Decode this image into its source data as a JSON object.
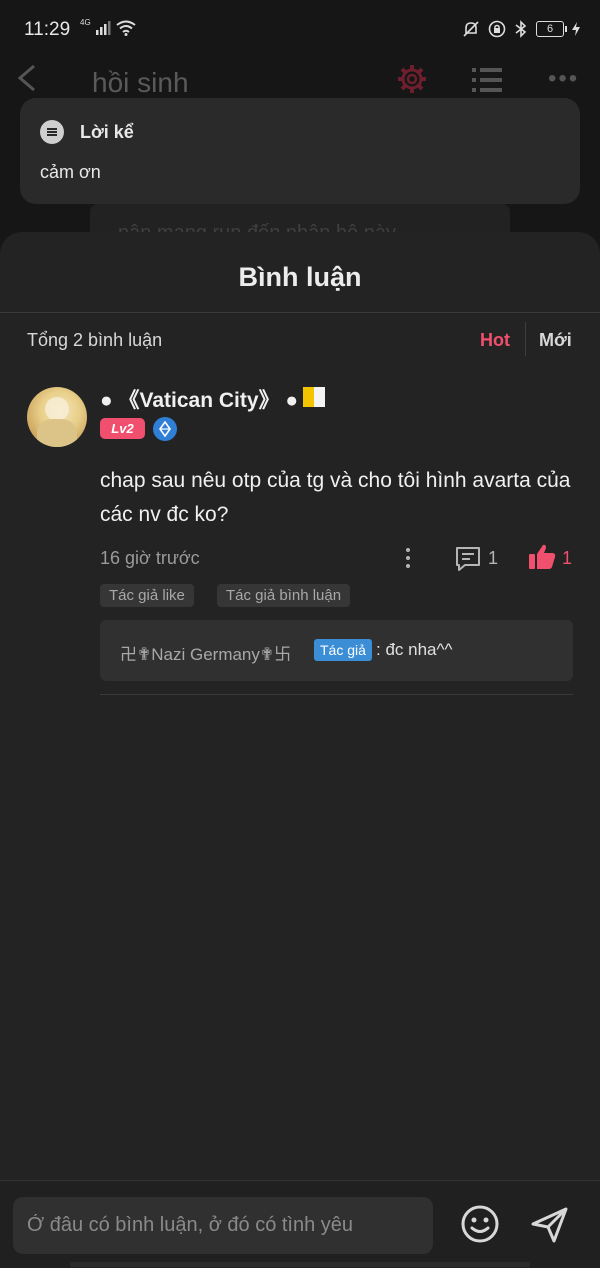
{
  "status_bar": {
    "time": "11:29",
    "network": "4G",
    "battery": "6"
  },
  "background_page": {
    "title": "hồi sinh",
    "note_card": {
      "title": "Lời kể",
      "body": "cảm ơn"
    },
    "faded_chip_text": "nân mang rụn đến nhận hộ này"
  },
  "comments_sheet": {
    "title": "Bình luận",
    "total": "Tổng 2 bình luận",
    "sort": {
      "hot": "Hot",
      "new": "Mới",
      "active_color": "#f0506e"
    },
    "comment": {
      "username": "● 《Vatican City》 ●",
      "level": "Lv2",
      "text": "chap sau nêu otp của tg và cho tôi hình avarta của các nv đc ko?",
      "time": "16 giờ trước",
      "reply_count": "1",
      "like_count": "1",
      "tags": [
        "Tác giả like",
        "Tác giả bình luận"
      ],
      "reply": {
        "author": "卍✟Nazi Germany✟卐",
        "author_badge": "Tác giả",
        "text": ": đc nha^^"
      }
    }
  },
  "input": {
    "placeholder": "Ở đâu có bình luận, ở đó có tình yêu"
  },
  "icons": {
    "back": "back-arrow-icon",
    "settings": "gear-icon",
    "list": "list-icon",
    "more": "more-horizontal-icon",
    "reply": "comment-icon",
    "like": "thumbs-up-icon",
    "emoji": "emoji-icon",
    "send": "send-icon"
  }
}
